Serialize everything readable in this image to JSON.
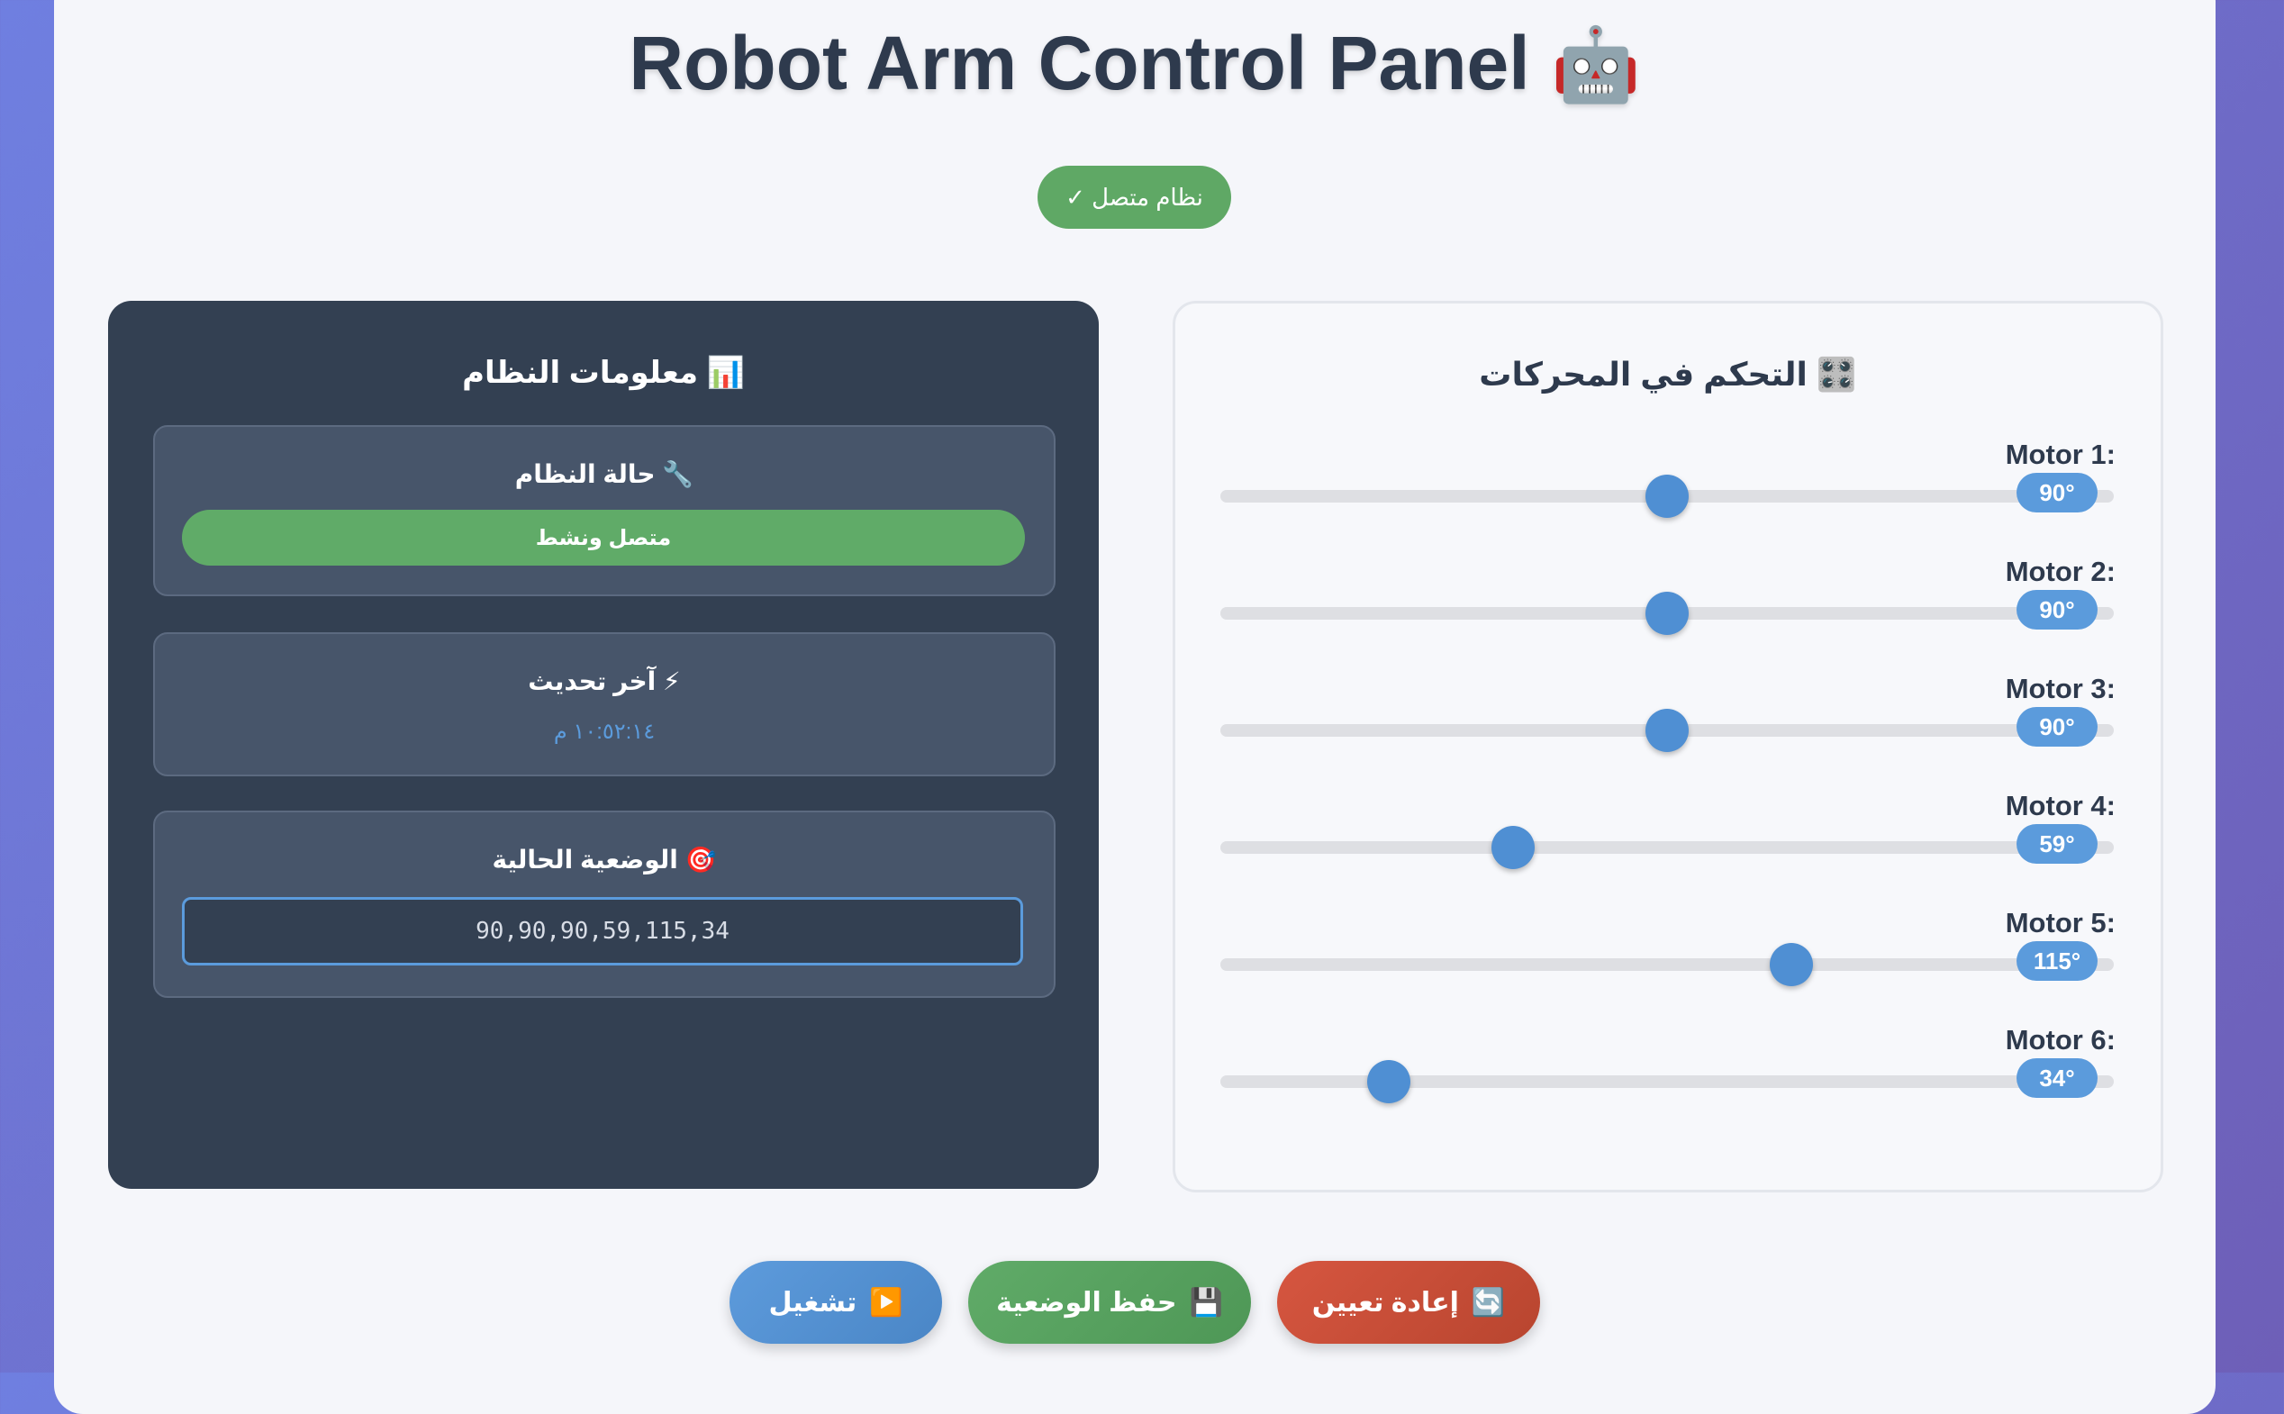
{
  "header": {
    "title": "Robot Arm Control Panel",
    "title_icon": "🤖",
    "status_pill": "نظام متصل ✓"
  },
  "info_panel": {
    "title": "📊 معلومات النظام",
    "system_status": {
      "title": "🔧 حالة النظام",
      "value": "متصل ونشط"
    },
    "last_update": {
      "title": "⚡ آخر تحديث",
      "value": "١٠:٥٢:١٤ م"
    },
    "current_position": {
      "title": "🎯 الوضعية الحالية",
      "value": "90,90,90,59,115,34"
    }
  },
  "motor_panel": {
    "title": "🎛️ التحكم في المحركات",
    "slider_max": 180,
    "motors": [
      {
        "label": "Motor 1:",
        "value": 90,
        "display": "90°"
      },
      {
        "label": "Motor 2:",
        "value": 90,
        "display": "90°"
      },
      {
        "label": "Motor 3:",
        "value": 90,
        "display": "90°"
      },
      {
        "label": "Motor 4:",
        "value": 59,
        "display": "59°"
      },
      {
        "label": "Motor 5:",
        "value": 115,
        "display": "115°"
      },
      {
        "label": "Motor 6:",
        "value": 34,
        "display": "34°"
      }
    ]
  },
  "buttons": {
    "run": {
      "label": "تشغيل",
      "icon": "▶️"
    },
    "save": {
      "label": "حفظ الوضعية",
      "icon": "💾"
    },
    "reset": {
      "label": "إعادة تعيين",
      "icon": "🔄"
    }
  },
  "colors": {
    "accent_blue": "#5b9bdc",
    "success_green": "#60ab68",
    "danger_red": "#d65640",
    "dark_panel": "#334052"
  }
}
